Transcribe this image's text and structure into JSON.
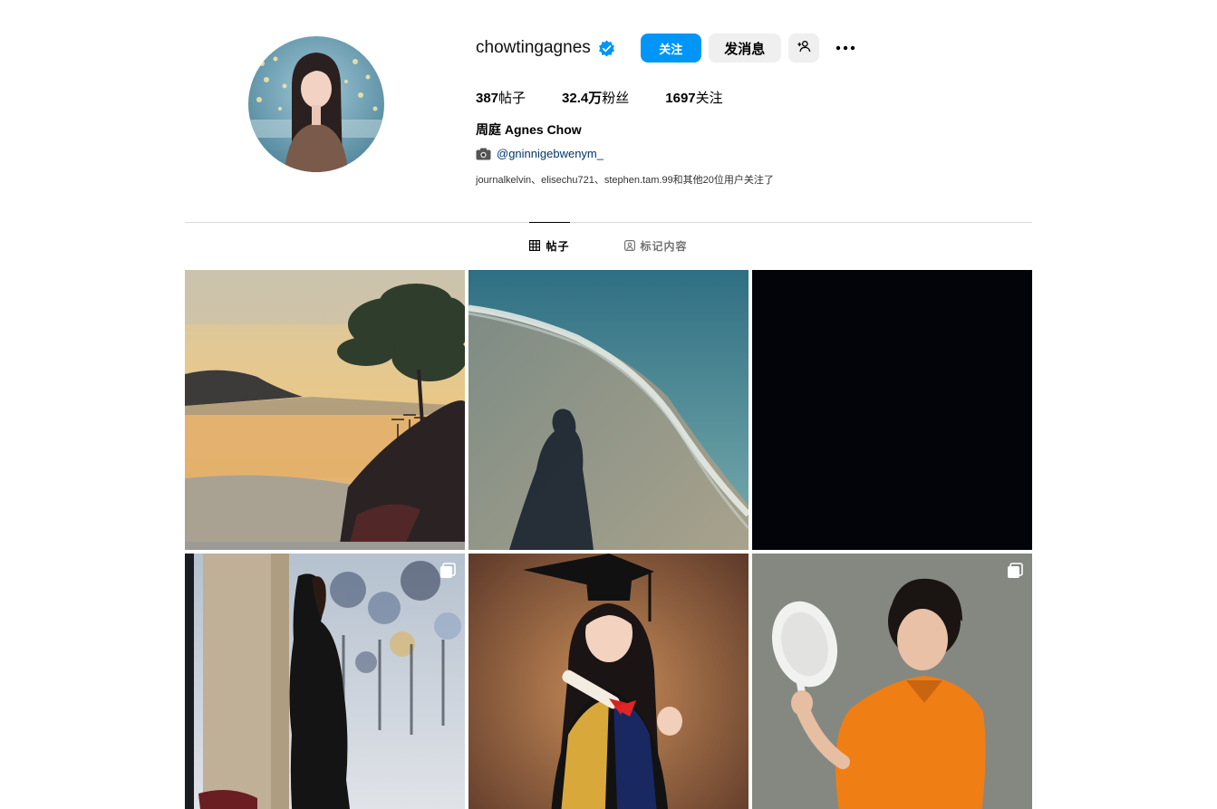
{
  "profile": {
    "username": "chowtingagnes",
    "verified": true,
    "follow_label": "关注",
    "message_label": "发消息",
    "suggest_icon": "add-person-icon",
    "more_icon": "more-horizontal-icon",
    "stats": {
      "posts": "387",
      "posts_label": "帖子",
      "followers": "32.4万",
      "followers_label": "粉丝",
      "following": "1697",
      "following_label": "关注"
    },
    "full_name": "周庭 Agnes Chow",
    "bio_link": "@gninnigebwenym_",
    "followed_by": "journalkelvin、elisechu721、stephen.tam.99和其他20位用户关注了"
  },
  "tabs": [
    {
      "label": "帖子",
      "icon": "grid-icon",
      "active": true
    },
    {
      "label": "标记内容",
      "icon": "tagged-icon",
      "active": false
    }
  ],
  "posts": [
    {
      "subject": "painting-sunset-tree",
      "multi": false
    },
    {
      "subject": "beach-shadow",
      "multi": false
    },
    {
      "subject": "black-square",
      "multi": false
    },
    {
      "subject": "woman-pillar",
      "multi": true
    },
    {
      "subject": "graduation-portrait",
      "multi": false
    },
    {
      "subject": "orange-shirt-colander",
      "multi": true
    }
  ],
  "colors": {
    "accent": "#0095f6",
    "verified": "#0095f6",
    "link": "#00376b",
    "muted": "#737373"
  }
}
